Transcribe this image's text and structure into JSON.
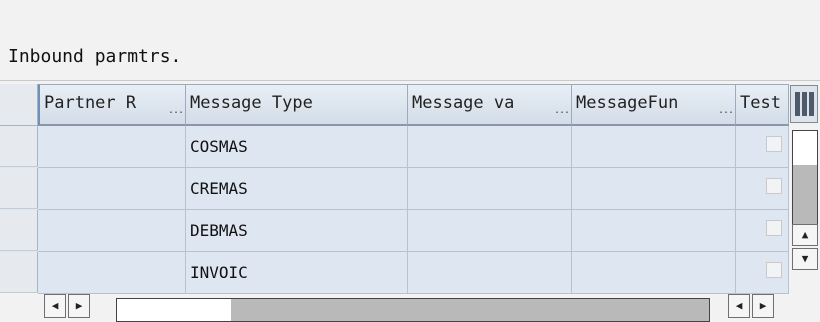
{
  "section": {
    "title": "Inbound parmtrs."
  },
  "table": {
    "columns": [
      {
        "label": "Partner R",
        "truncated": true
      },
      {
        "label": "Message Type",
        "truncated": false
      },
      {
        "label": "Message va",
        "truncated": true
      },
      {
        "label": "MessageFun",
        "truncated": true
      },
      {
        "label": "Test",
        "truncated": false
      }
    ],
    "rows": [
      {
        "partner_role": "",
        "message_type": "COSMAS",
        "message_variant": "",
        "message_function": "",
        "test": false
      },
      {
        "partner_role": "",
        "message_type": "CREMAS",
        "message_variant": "",
        "message_function": "",
        "test": false
      },
      {
        "partner_role": "",
        "message_type": "DEBMAS",
        "message_variant": "",
        "message_function": "",
        "test": false
      },
      {
        "partner_role": "",
        "message_type": "INVOIC",
        "message_variant": "",
        "message_function": "",
        "test": false
      }
    ],
    "ellipsis": "..."
  },
  "icons": {
    "column_settings": "table-settings-icon",
    "scroll_up": "arrow-up-icon",
    "scroll_down": "arrow-down-icon",
    "scroll_left": "arrow-left-icon",
    "scroll_right": "arrow-right-icon"
  },
  "colors": {
    "cell_bg": "#dde6f1",
    "header_bg": "#d3dde8",
    "page_bg": "#f2f2f2"
  }
}
